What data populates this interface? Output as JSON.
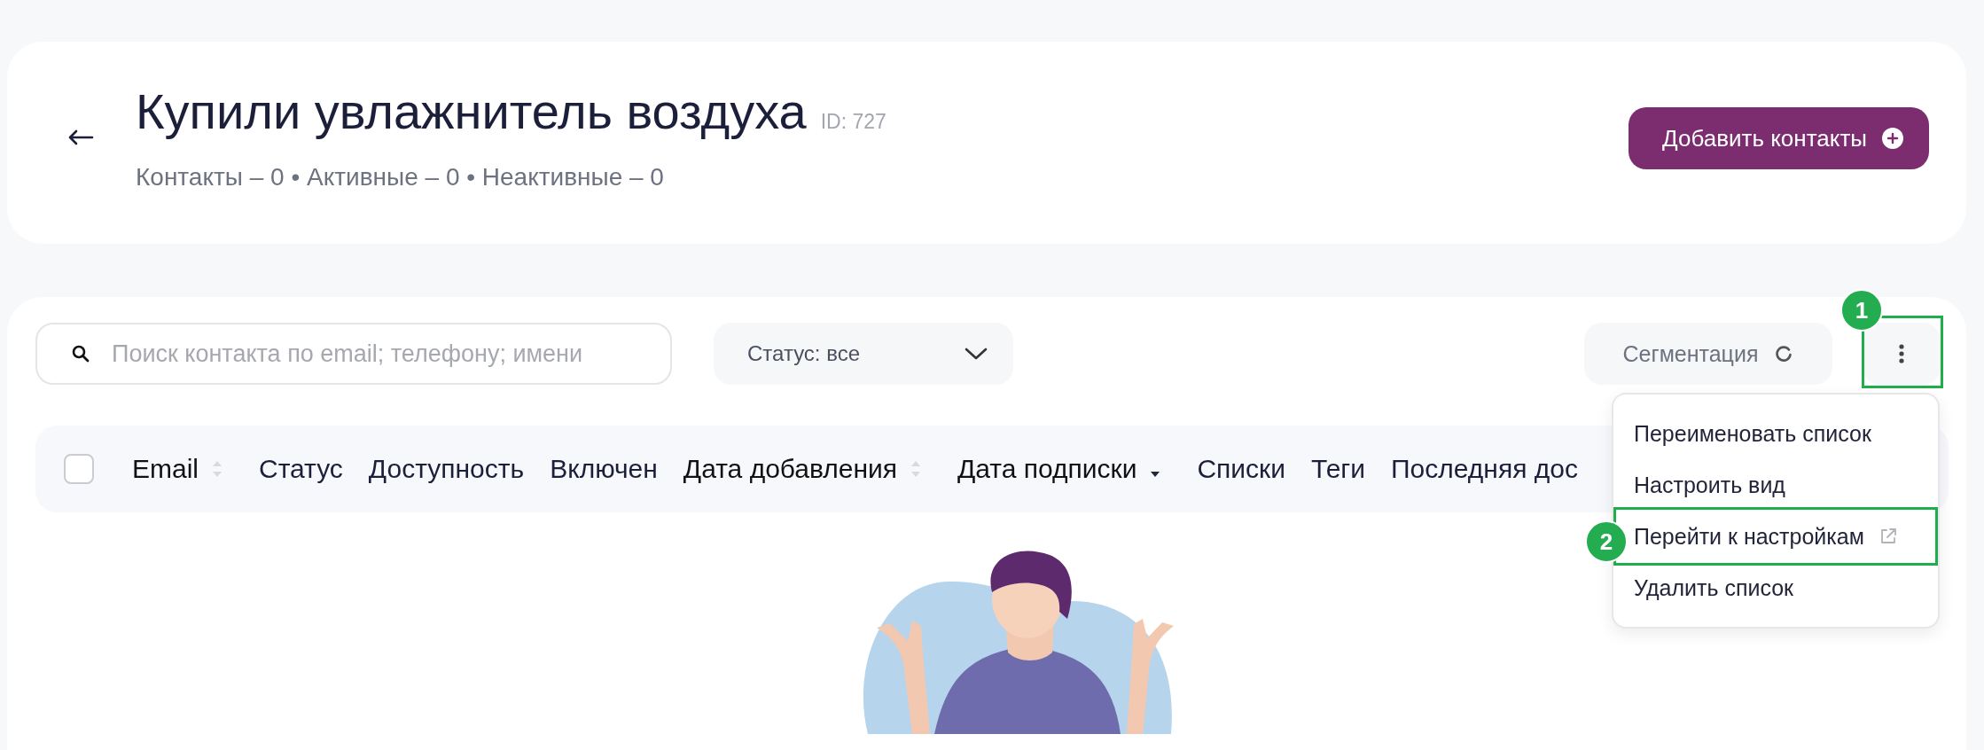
{
  "header": {
    "title": "Купили увлажнитель воздуха",
    "id_label": "ID: 727",
    "stats": "Контакты – 0 • Активные – 0 • Неактивные – 0",
    "add_button": "Добавить контакты"
  },
  "toolbar": {
    "search": {
      "placeholder": "Поиск контакта по email; телефону; имени"
    },
    "status_filter": "Статус: все",
    "segmentation_button": "Сегментация",
    "more_button": {
      "annotation": "1",
      "expanded": true
    }
  },
  "table": {
    "select_all": {
      "checked": false
    },
    "columns": [
      {
        "label": "Email",
        "sortable": true,
        "sorted": false
      },
      {
        "label": "Статус"
      },
      {
        "label": "Доступность"
      },
      {
        "label": "Включен"
      },
      {
        "label": "Дата добавления",
        "sortable": true,
        "sorted": false
      },
      {
        "label": "Дата подписки",
        "sortable": true,
        "sorted": true
      },
      {
        "label": "Списки"
      },
      {
        "label": "Теги"
      },
      {
        "label": "Последняя дос"
      }
    ]
  },
  "menu": {
    "items": [
      {
        "label": "Переименовать список",
        "external": false
      },
      {
        "label": "Настроить вид",
        "external": false
      },
      {
        "label": "Перейти к настройкам",
        "external": true,
        "annotation": "2"
      },
      {
        "label": "Удалить список",
        "external": false
      }
    ]
  }
}
